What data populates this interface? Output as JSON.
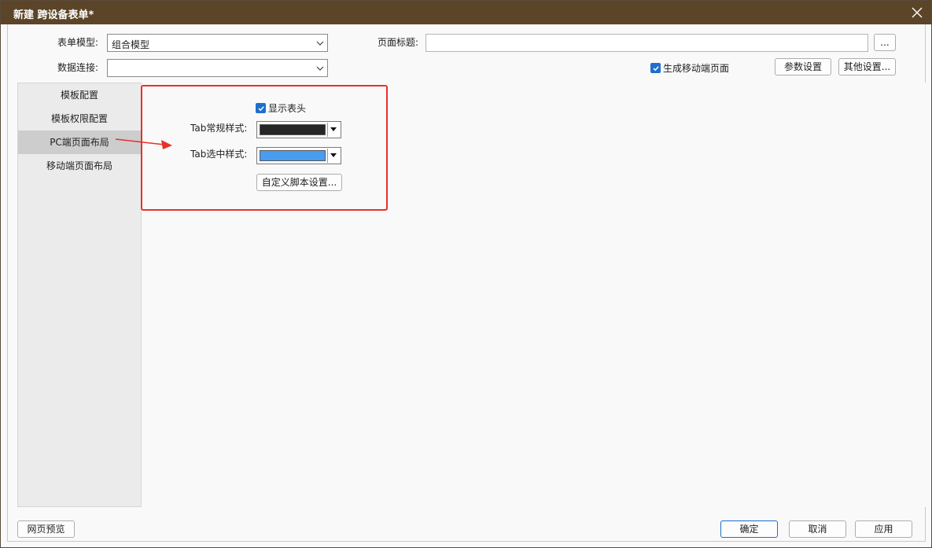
{
  "window": {
    "title": "新建 跨设备表单*"
  },
  "form": {
    "model_label": "表单模型:",
    "model_value": "组合模型",
    "connection_label": "数据连接:",
    "connection_value": "",
    "page_title_label": "页面标题:",
    "page_title_value": "",
    "browse_label": "...",
    "generate_mobile_label": "生成移动端页面",
    "generate_mobile_checked": true,
    "param_settings_label": "参数设置",
    "other_settings_label": "其他设置..."
  },
  "sidebar": {
    "items": [
      {
        "label": "模板配置",
        "active": false
      },
      {
        "label": "模板权限配置",
        "active": false
      },
      {
        "label": "PC端页面布局",
        "active": true
      },
      {
        "label": "移动端页面布局",
        "active": false
      }
    ]
  },
  "layout_panel": {
    "show_header_label": "显示表头",
    "show_header_checked": true,
    "tab_normal_label": "Tab常规样式:",
    "tab_normal_color": "#262626",
    "tab_selected_label": "Tab选中样式:",
    "tab_selected_color": "#4a9cf0",
    "custom_script_label": "自定义脚本设置..."
  },
  "footer": {
    "preview_label": "网页预览",
    "ok_label": "确定",
    "cancel_label": "取消",
    "apply_label": "应用"
  },
  "colors": {
    "titlebar": "#5c4428",
    "highlight": "#e8302a",
    "accent": "#1e6fd0"
  }
}
